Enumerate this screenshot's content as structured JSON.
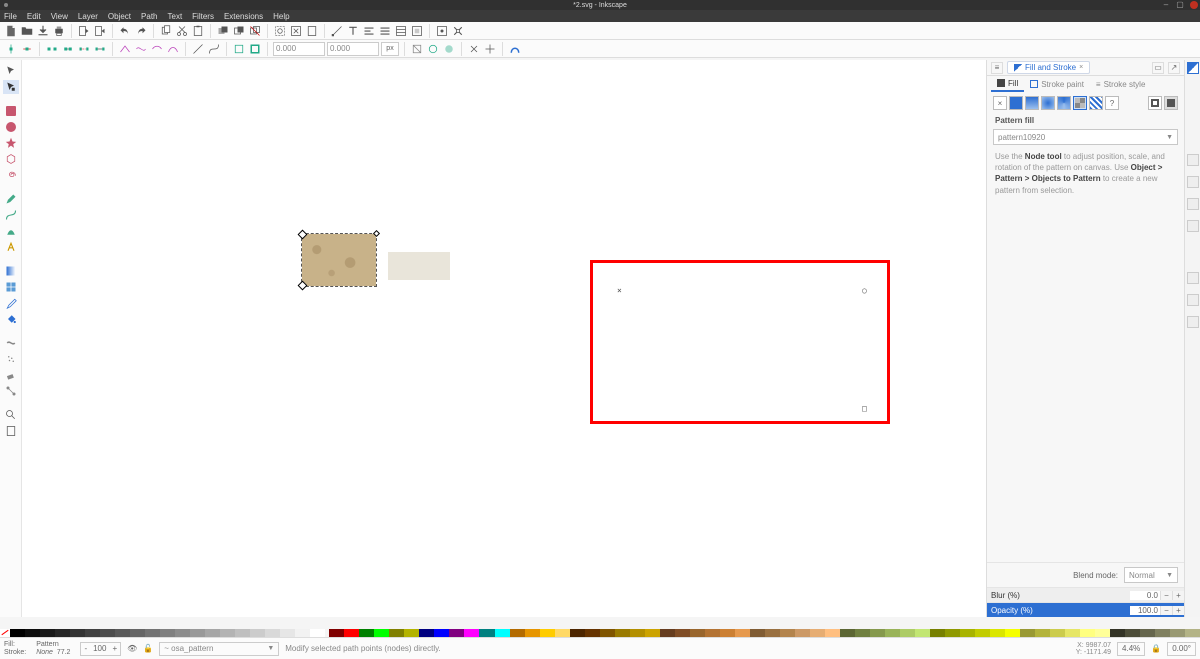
{
  "title": "*2.svg - Inkscape",
  "menu": [
    "File",
    "Edit",
    "View",
    "Layer",
    "Object",
    "Path",
    "Text",
    "Filters",
    "Extensions",
    "Help"
  ],
  "toolbar2": {
    "x": "0.000",
    "y": "0.000",
    "unit": "px"
  },
  "panel": {
    "tab": "Fill and Stroke",
    "subtabs": {
      "fill": "Fill",
      "stroke_paint": "Stroke paint",
      "stroke_style": "Stroke style"
    },
    "section": "Pattern fill",
    "pattern_combo": "pattern10920",
    "hint_pre": "Use the ",
    "hint_bold1": "Node tool",
    "hint_mid": " to adjust position, scale, and rotation of the pattern on canvas. Use ",
    "hint_bold2": "Object > Pattern > Objects to Pattern",
    "hint_post": " to create a new pattern from selection.",
    "blend_label": "Blend mode:",
    "blend_value": "Normal",
    "blur_label": "Blur (%)",
    "blur_value": "0.0",
    "opacity_label": "Opacity (%)",
    "opacity_value": "100.0"
  },
  "status": {
    "fill_label": "Fill:",
    "fill_value": "Pattern",
    "stroke_label": "Stroke:",
    "stroke_value": "None",
    "stroke_w": "77.2",
    "opacity": "100",
    "layer": "~ osa_pattern",
    "hint": "Modify selected path points (nodes) directly.",
    "x_label": "X:",
    "x": "9987.07",
    "y_label": "Y:",
    "y": "-1171.49",
    "zoom": "4.4%",
    "rot": "0.00°"
  },
  "palette_greys": [
    "#000000",
    "#0d0d0d",
    "#1a1a1a",
    "#262626",
    "#333333",
    "#404040",
    "#4d4d4d",
    "#595959",
    "#666666",
    "#737373",
    "#808080",
    "#8c8c8c",
    "#999999",
    "#a6a6a6",
    "#b3b3b3",
    "#bfbfbf",
    "#cccccc",
    "#d9d9d9",
    "#e6e6e6",
    "#f2f2f2",
    "#ffffff"
  ],
  "palette_colors": [
    "#800000",
    "#ff0000",
    "#008000",
    "#00ff00",
    "#808000",
    "#b3b300",
    "#000080",
    "#0000ff",
    "#800080",
    "#ff00ff",
    "#008080",
    "#00ffff",
    "#b36b00",
    "#e69500",
    "#ffcc00",
    "#ffd966",
    "#4d2600",
    "#663300",
    "#805500",
    "#997a00",
    "#b38f00",
    "#cca300",
    "#663d1f",
    "#804d26",
    "#99662d",
    "#b37333",
    "#cc8033",
    "#e6994d",
    "#805c33",
    "#997040",
    "#b3844d",
    "#cc9966",
    "#e6ad73",
    "#ffbf80",
    "#5c6633",
    "#708040",
    "#85994d",
    "#99b359",
    "#adcc66",
    "#c2e673",
    "#778000",
    "#8f9900",
    "#a8b300",
    "#c2cc00",
    "#dbe600",
    "#f5ff00",
    "#999933",
    "#b3b33b",
    "#cccc4d",
    "#e6e666",
    "#ffff80",
    "#ffff99",
    "#333326",
    "#4d4d39",
    "#66664d",
    "#808060",
    "#999973",
    "#b3b386"
  ]
}
